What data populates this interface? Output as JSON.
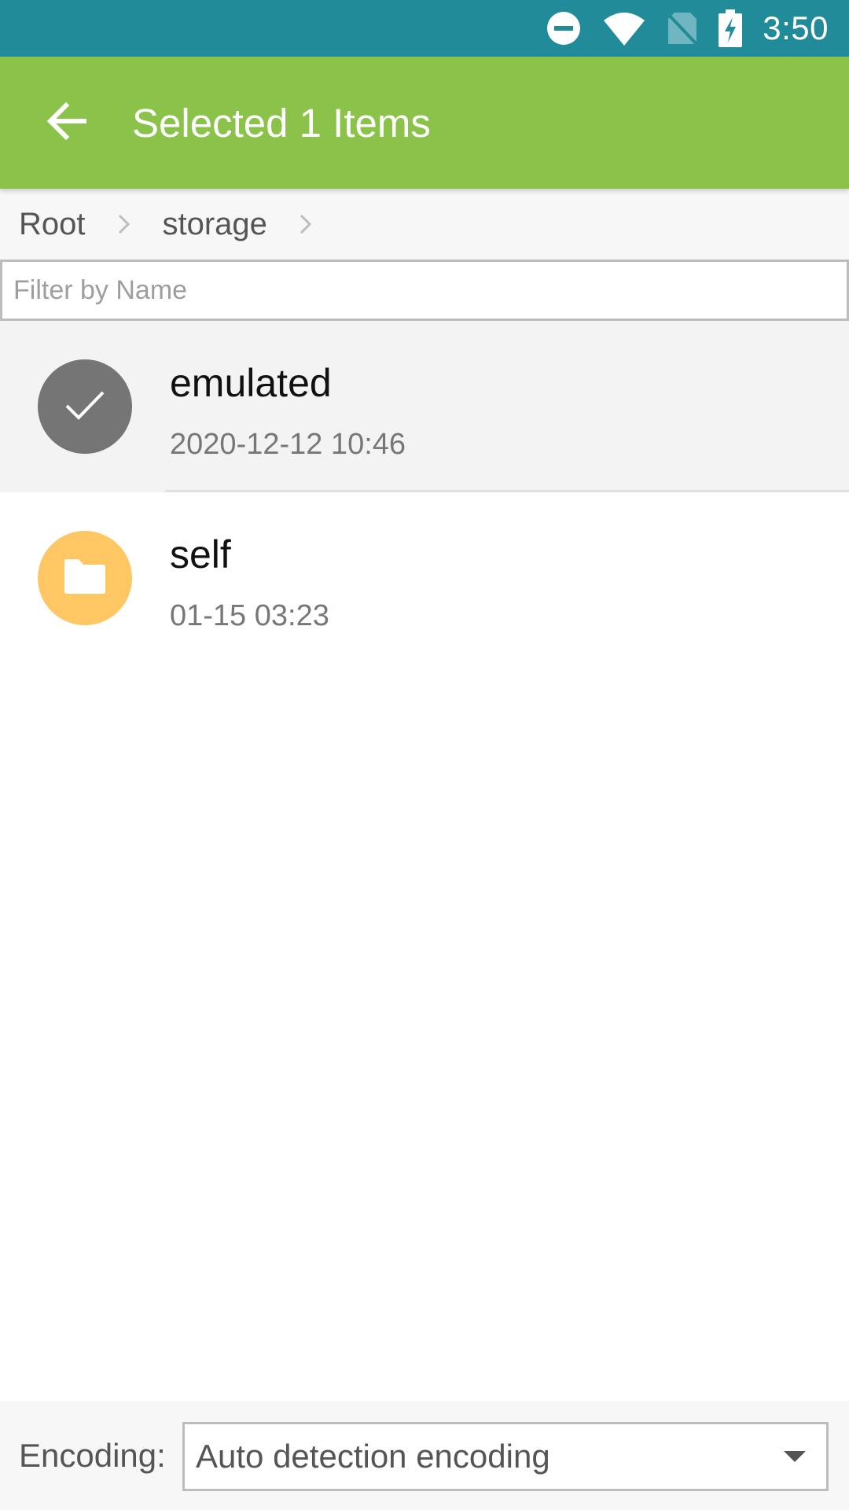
{
  "status_bar": {
    "time": "3:50",
    "icons": [
      "do-not-disturb-icon",
      "wifi-icon",
      "no-sim-icon",
      "battery-charging-icon"
    ]
  },
  "app_bar": {
    "title": "Selected 1 Items",
    "back_icon": "arrow-back-icon",
    "background_color": "#8BC34A"
  },
  "breadcrumb": {
    "items": [
      "Root",
      "storage"
    ]
  },
  "filter": {
    "placeholder": "Filter by Name",
    "value": ""
  },
  "files": [
    {
      "name": "emulated",
      "date": "2020-12-12 10:46",
      "icon": "check-icon",
      "selected": true
    },
    {
      "name": "self",
      "date": "01-15 03:23",
      "icon": "folder-icon",
      "selected": false
    }
  ],
  "encoding": {
    "label": "Encoding:",
    "selected": "Auto detection encoding"
  },
  "colors": {
    "status_bar": "#228B9A",
    "accent": "#8BC34A",
    "folder": "#FFC764",
    "selected_avatar": "#757575"
  }
}
